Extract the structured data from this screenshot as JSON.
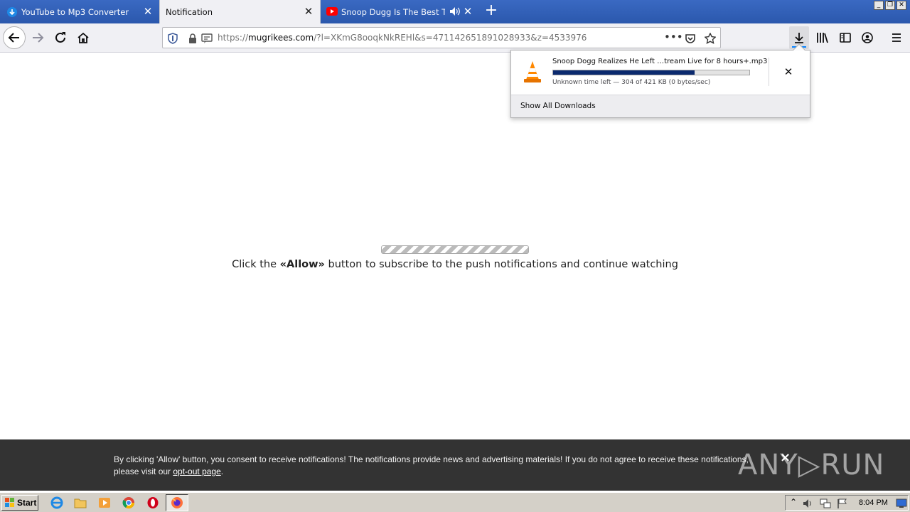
{
  "tabs": [
    {
      "title": "YouTube to Mp3 Converter",
      "icon": "download-cloud-icon"
    },
    {
      "title": "Notification",
      "icon": ""
    },
    {
      "title": "Snoop Dugg Is The Best Twitch",
      "icon": "youtube-icon"
    }
  ],
  "url": {
    "prefix": "https://",
    "host": "mugrikees.com",
    "rest": "/?l=XKmG8ooqkNkREHl&s=471142651891028933&z=4533976"
  },
  "download": {
    "filename": "Snoop Dogg Realizes He Left …tream Live for 8 hours+.mp3",
    "status": "Unknown time left — 304 of 421 KB (0 bytes/sec)",
    "progress": 0.722,
    "show_all": "Show All Downloads"
  },
  "page": {
    "msg_before": "Click the ",
    "msg_allow": "«Allow»",
    "msg_after": " button to subscribe to the push notifications and continue watching"
  },
  "consent": {
    "text": "By clicking 'Allow' button, you consent to receive notifications! The notifications provide news and advertising materials! If you do not agree to receive these notifications, please visit our ",
    "link": "opt-out page",
    "end": ".",
    "close": "×"
  },
  "watermark": "ANY▷RUN",
  "taskbar": {
    "start": "Start",
    "clock": "8:04 PM"
  },
  "colors": {
    "tabbar": "#2b58ad",
    "progress": "#0b2a6e",
    "consent_bg": "#333333"
  }
}
